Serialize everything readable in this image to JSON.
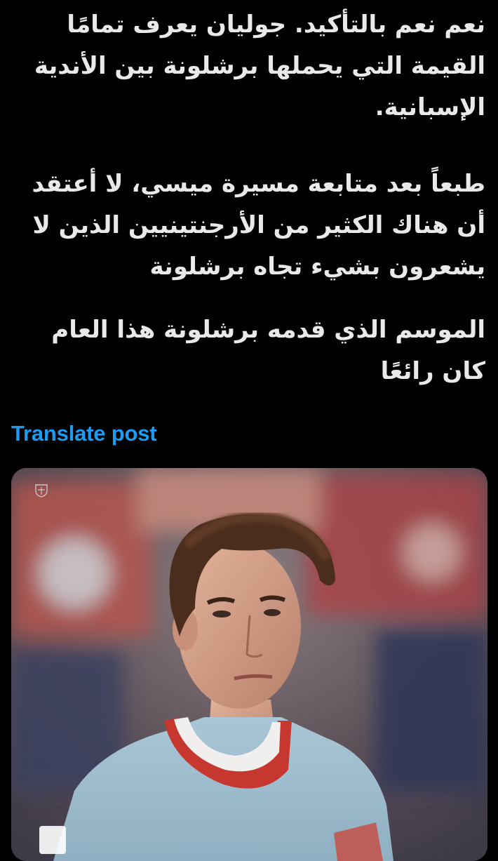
{
  "post": {
    "paragraphs": [
      "نعم نعم بالتأكيد. جوليان يعرف تمامًا القيمة التي يحملها برشلونة بين الأندية الإسبانية.",
      "طبعاً بعد متابعة مسيرة ميسي، لا أعتقد أن هناك الكثير من الأرجنتينيين الذين لا يشعرون بشيء تجاه برشلونة",
      "الموسم الذي قدمه برشلونة هذا العام كان رائعًا"
    ],
    "translate_label": "Translate post"
  },
  "media": {
    "type": "photo",
    "subject": "football player in light blue jersey with red collar"
  },
  "colors": {
    "background": "#000000",
    "text": "#e7e9ea",
    "link": "#1d9bf0"
  }
}
